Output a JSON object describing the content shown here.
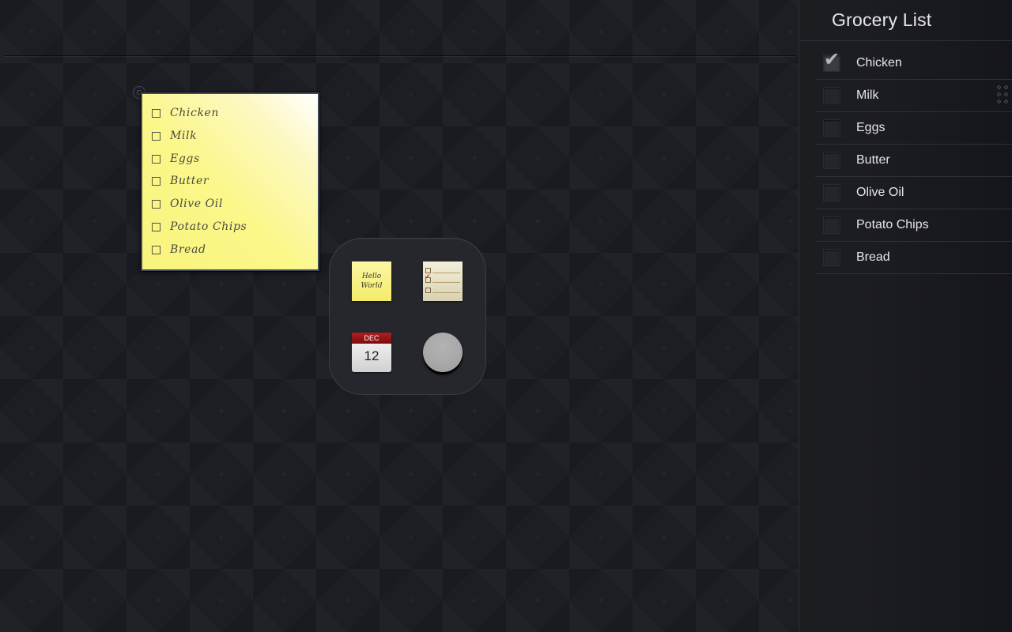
{
  "sticky_note": {
    "items": [
      "Chicken",
      "Milk",
      "Eggs",
      "Butter",
      "Olive Oil",
      "Potato Chips",
      "Bread"
    ]
  },
  "widget_picker": {
    "sticky_widget_text": "Hello World",
    "calendar_widget": {
      "month": "DEC",
      "day": "12"
    }
  },
  "sidebar": {
    "title": "Grocery List",
    "items": [
      {
        "label": "Chicken",
        "checked": true
      },
      {
        "label": "Milk",
        "checked": false
      },
      {
        "label": "Eggs",
        "checked": false
      },
      {
        "label": "Butter",
        "checked": false
      },
      {
        "label": "Olive Oil",
        "checked": false
      },
      {
        "label": "Potato Chips",
        "checked": false
      },
      {
        "label": "Bread",
        "checked": false
      }
    ]
  },
  "colors": {
    "note_yellow": "#fbf78a",
    "calendar_red": "#9e1515",
    "background": "#1c1e24"
  }
}
